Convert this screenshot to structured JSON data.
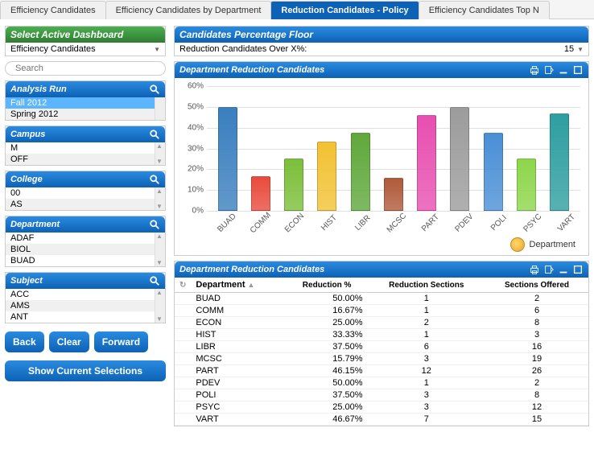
{
  "tabs": [
    {
      "label": "Efficiency Candidates",
      "active": false
    },
    {
      "label": "Efficiency Candidates by Department",
      "active": false
    },
    {
      "label": "Reduction Candidates - Policy",
      "active": true
    },
    {
      "label": "Efficiency Candidates Top N",
      "active": false
    }
  ],
  "sidebar": {
    "select_dashboard": {
      "header": "Select Active Dashboard",
      "value": "Efficiency Candidates"
    },
    "search": {
      "placeholder": "Search"
    },
    "analysis_run": {
      "header": "Analysis Run",
      "items": [
        "Fall 2012",
        "Spring 2012"
      ],
      "selected": 0
    },
    "campus": {
      "header": "Campus",
      "items": [
        "M",
        "OFF"
      ]
    },
    "college": {
      "header": "College",
      "items": [
        "00",
        "AS"
      ]
    },
    "department": {
      "header": "Department",
      "items": [
        "ADAF",
        "BIOL",
        "BUAD"
      ]
    },
    "subject": {
      "header": "Subject",
      "items": [
        "ACC",
        "AMS",
        "ANT"
      ]
    },
    "buttons": {
      "back": "Back",
      "clear": "Clear",
      "forward": "Forward",
      "show": "Show Current Selections"
    }
  },
  "content": {
    "floor": {
      "header": "Candidates Percentage Floor",
      "label": "Reduction Candidates Over X%:",
      "value": "15"
    },
    "chart_panel": {
      "header": "Department Reduction Candidates"
    },
    "table_panel": {
      "header": "Department Reduction Candidates"
    },
    "legend": "Department"
  },
  "chart_data": {
    "type": "bar",
    "categories": [
      "BUAD",
      "COMM",
      "ECON",
      "HIST",
      "LIBR",
      "MCSC",
      "PART",
      "PDEV",
      "POLI",
      "PSYC",
      "VART"
    ],
    "values": [
      50.0,
      16.67,
      25.0,
      33.33,
      37.5,
      15.79,
      46.15,
      50.0,
      37.5,
      25.0,
      46.67
    ],
    "colors": [
      "#3a7fbf",
      "#e94b3c",
      "#7bbf3a",
      "#f2c233",
      "#5fa83b",
      "#b05a3a",
      "#e84fb0",
      "#9c9c9c",
      "#4a8fd6",
      "#8dd64a",
      "#2e9ea0"
    ],
    "title": "Department Reduction Candidates",
    "xlabel": "Department",
    "ylabel": "",
    "ylim": [
      0,
      60
    ],
    "yticks": [
      0,
      10,
      20,
      30,
      40,
      50,
      60
    ]
  },
  "table": {
    "columns": [
      "Department",
      "Reduction %",
      "Reduction Sections",
      "Sections Offered"
    ],
    "rows": [
      {
        "dept": "BUAD",
        "pct": "50.00%",
        "red": "1",
        "off": "2"
      },
      {
        "dept": "COMM",
        "pct": "16.67%",
        "red": "1",
        "off": "6"
      },
      {
        "dept": "ECON",
        "pct": "25.00%",
        "red": "2",
        "off": "8"
      },
      {
        "dept": "HIST",
        "pct": "33.33%",
        "red": "1",
        "off": "3"
      },
      {
        "dept": "LIBR",
        "pct": "37.50%",
        "red": "6",
        "off": "16"
      },
      {
        "dept": "MCSC",
        "pct": "15.79%",
        "red": "3",
        "off": "19"
      },
      {
        "dept": "PART",
        "pct": "46.15%",
        "red": "12",
        "off": "26"
      },
      {
        "dept": "PDEV",
        "pct": "50.00%",
        "red": "1",
        "off": "2"
      },
      {
        "dept": "POLI",
        "pct": "37.50%",
        "red": "3",
        "off": "8"
      },
      {
        "dept": "PSYC",
        "pct": "25.00%",
        "red": "3",
        "off": "12"
      },
      {
        "dept": "VART",
        "pct": "46.67%",
        "red": "7",
        "off": "15"
      }
    ]
  }
}
